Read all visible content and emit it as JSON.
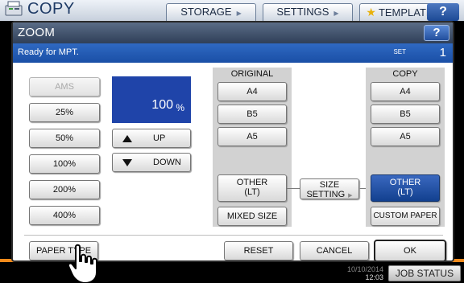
{
  "app": {
    "title": "COPY",
    "tabs": [
      {
        "label": "STORAGE"
      },
      {
        "label": "SETTINGS"
      },
      {
        "label": "TEMPLATE"
      }
    ],
    "help": "?"
  },
  "dialog": {
    "title": "ZOOM",
    "help": "?",
    "status": "Ready for MPT.",
    "set_label": "SET",
    "set_count": "1"
  },
  "zoom": {
    "ams": "AMS",
    "presets": [
      "25%",
      "50%",
      "100%",
      "200%",
      "400%"
    ],
    "value": "100",
    "unit": "%",
    "up": "UP",
    "down": "DOWN"
  },
  "original": {
    "label": "ORIGINAL",
    "sizes": [
      "A4",
      "B5",
      "A5"
    ],
    "other_line1": "OTHER",
    "other_line2": "(LT)",
    "mixed": "MIXED SIZE"
  },
  "size_setting": {
    "line1": "SIZE",
    "line2": "SETTING"
  },
  "copy": {
    "label": "COPY",
    "sizes": [
      "A4",
      "B5",
      "A5"
    ],
    "other_line1": "OTHER",
    "other_line2": "(LT)",
    "custom": "CUSTOM PAPER"
  },
  "footer": {
    "paper_type": "PAPER TYPE",
    "reset": "RESET",
    "cancel": "CANCEL",
    "ok": "OK"
  },
  "system": {
    "date": "10/10/2014",
    "time": "12:03",
    "job_status": "JOB STATUS"
  },
  "colors": {
    "accent_blue": "#1f44a9",
    "status_bar": "#2f69c2",
    "orange_line": "#f28a1b"
  }
}
